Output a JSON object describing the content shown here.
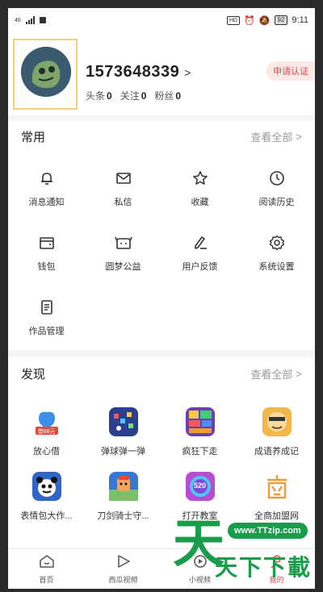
{
  "status_bar": {
    "carrier": "46",
    "hd": "HD",
    "battery": "92",
    "time": "9:11"
  },
  "profile": {
    "username": "1573648339",
    "stats": [
      {
        "label": "头条",
        "value": "0"
      },
      {
        "label": "关注",
        "value": "0"
      },
      {
        "label": "粉丝",
        "value": "0"
      }
    ],
    "verify_label": "申请认证"
  },
  "common": {
    "title": "常用",
    "more_label": "查看全部",
    "items": [
      {
        "label": "消息通知",
        "icon": "bell-icon"
      },
      {
        "label": "私信",
        "icon": "mail-icon"
      },
      {
        "label": "收藏",
        "icon": "star-icon"
      },
      {
        "label": "阅读历史",
        "icon": "clock-icon"
      },
      {
        "label": "钱包",
        "icon": "wallet-icon"
      },
      {
        "label": "圆梦公益",
        "icon": "charity-icon"
      },
      {
        "label": "用户反馈",
        "icon": "feedback-icon"
      },
      {
        "label": "系统设置",
        "icon": "gear-icon"
      },
      {
        "label": "作品管理",
        "icon": "document-icon"
      }
    ]
  },
  "discover": {
    "title": "发现",
    "more_label": "查看全部",
    "items": [
      {
        "label": "放心借",
        "icon": "loan-app-icon",
        "badge": "借88元",
        "color": "#e8453c"
      },
      {
        "label": "弹球弹一弹",
        "icon": "pinball-game-icon",
        "color": "#2b3f8f"
      },
      {
        "label": "疯狂下走",
        "icon": "crazy-down-game-icon",
        "color": "#6a3fb0"
      },
      {
        "label": "成语养成记",
        "icon": "idiom-game-icon",
        "color": "#f2b84b"
      },
      {
        "label": "表情包大作...",
        "icon": "meme-app-icon",
        "color": "#2f66c8"
      },
      {
        "label": "刀剑骑士守...",
        "icon": "knight-game-icon",
        "color": "#3a77d4"
      },
      {
        "label": "打开教室",
        "icon": "classroom-app-icon",
        "badge": "520",
        "color": "#b84ad6"
      },
      {
        "label": "全商加盟网",
        "icon": "franchise-app-icon",
        "color": "#ffffff"
      }
    ]
  },
  "tabbar": {
    "tabs": [
      {
        "label": "首页",
        "icon": "home-icon"
      },
      {
        "label": "西瓜视频",
        "icon": "video-play-icon"
      },
      {
        "label": "小视频",
        "icon": "short-video-icon"
      },
      {
        "label": "我的",
        "icon": "profile-icon"
      }
    ]
  },
  "watermark": {
    "url": "www.TTzip.com",
    "text": "天下下載",
    "big_char": "天"
  },
  "colors": {
    "accent": "#e04a4a",
    "watermark": "#1a9d4a"
  }
}
